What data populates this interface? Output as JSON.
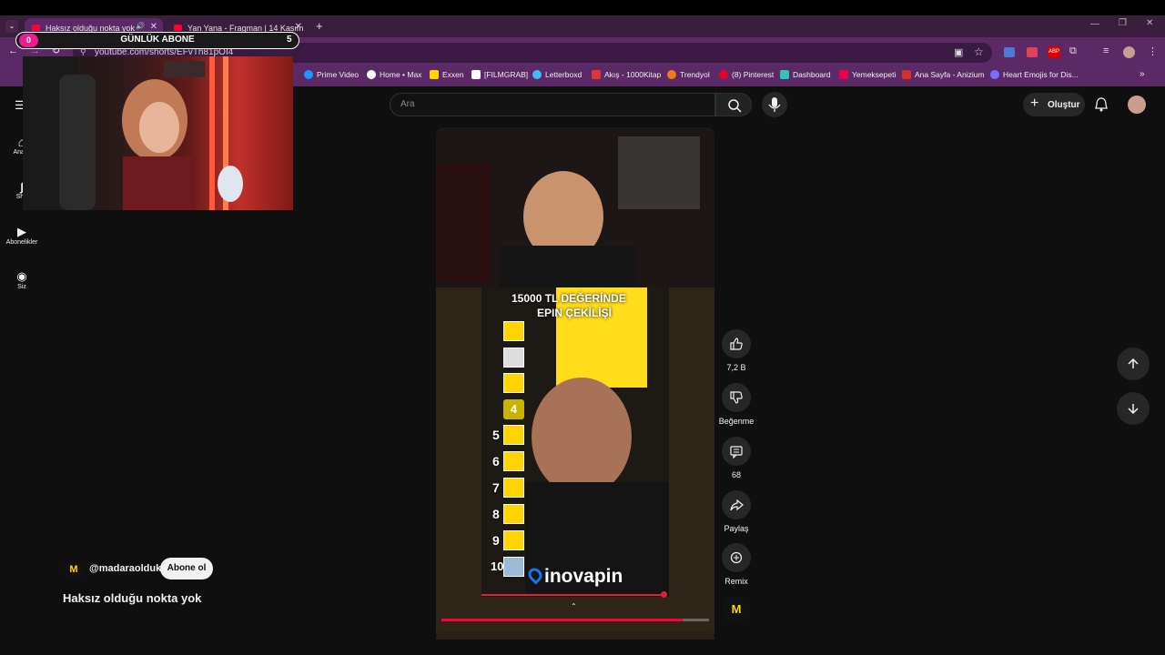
{
  "browser": {
    "tabs": [
      {
        "title": "Haksız olduğu nokta yok -",
        "active": true
      },
      {
        "title": "Yan Yana - Fragman | 14 Kasım",
        "active": false
      }
    ],
    "url": "youtube.com/shorts/EFvTh81pOI4",
    "bookmarks": [
      {
        "label": "Prime Video",
        "color": "#1a98ff"
      },
      {
        "label": "Home • Max",
        "color": "#ffffff"
      },
      {
        "label": "Exxen",
        "color": "#ffd400"
      },
      {
        "label": "[FILMGRAB]",
        "color": "#ffffff"
      },
      {
        "label": "Letterboxd",
        "color": "#40bcf4"
      },
      {
        "label": "Akış - 1000Kitap",
        "color": "#e0343b"
      },
      {
        "label": "Trendyol",
        "color": "#f27a1a"
      },
      {
        "label": "(8) Pinterest",
        "color": "#e60023"
      },
      {
        "label": "Dashboard",
        "color": "#2ec4b6"
      },
      {
        "label": "Yemeksepeti",
        "color": "#ea004b"
      },
      {
        "label": "Ana Sayfa - Anizium",
        "color": "#d92d2d"
      },
      {
        "label": "Heart Emojis for Dis...",
        "color": "#7b6cff"
      }
    ]
  },
  "stream_overlay": {
    "title": "GÜNLÜK ABONE",
    "current": "0",
    "goal": "5",
    "accent": "#e91e8c"
  },
  "youtube": {
    "search_placeholder": "Ara",
    "create_label": "Oluştur",
    "sidebar": [
      {
        "label": "Ana S",
        "icon": "home-icon"
      },
      {
        "label": "Sho",
        "icon": "shorts-icon"
      },
      {
        "label": "Abonelikler",
        "icon": "subscriptions-icon"
      },
      {
        "label": "Siz",
        "icon": "you-icon"
      }
    ],
    "short": {
      "channel": "@madaraolduk",
      "subscribe_label": "Abone ol",
      "title": "Haksız olduğu nokta yok",
      "overlay_title": "15000 TL DEĞERİNDE",
      "overlay_subtitle": "EPIN ÇEKİLİŞİ",
      "sponsor": "inovapin",
      "ranks": [
        "4",
        "5",
        "6",
        "7",
        "8",
        "9",
        "10"
      ],
      "progress": 0.9
    },
    "actions": {
      "like_count": "7,2 B",
      "dislike_label": "Beğenme",
      "comments_count": "68",
      "share_label": "Paylaş",
      "remix_label": "Remix"
    }
  }
}
